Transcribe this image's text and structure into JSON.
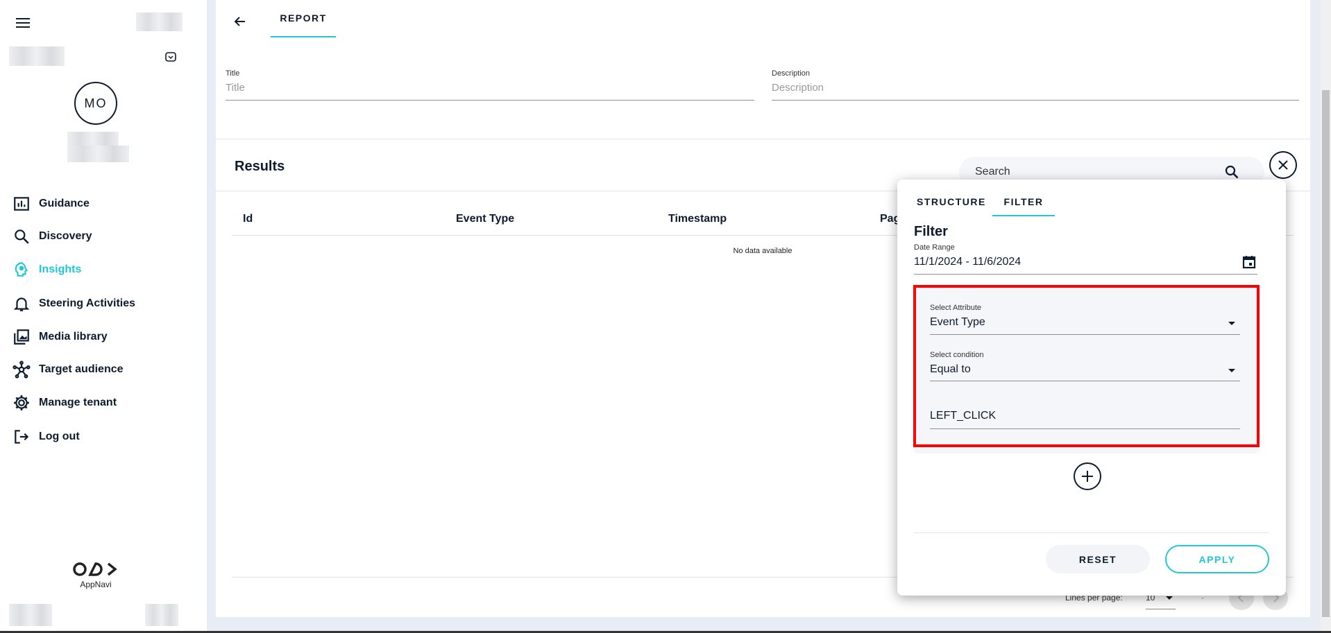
{
  "colors": {
    "accent": "#1ec8d8",
    "text": "#0d1b2e",
    "highlight": "#ff0000"
  },
  "sidebar": {
    "avatar_initials": "MO",
    "items": [
      {
        "label": "Guidance",
        "icon": "bar-chart-icon"
      },
      {
        "label": "Discovery",
        "icon": "search-icon"
      },
      {
        "label": "Insights",
        "icon": "lightbulb-head-icon",
        "active": true
      },
      {
        "label": "Steering Activities",
        "icon": "bell-icon"
      },
      {
        "label": "Media library",
        "icon": "image-library-icon"
      },
      {
        "label": "Target audience",
        "icon": "network-icon"
      },
      {
        "label": "Manage tenant",
        "icon": "gear-icon"
      },
      {
        "label": "Log out",
        "icon": "logout-icon"
      }
    ],
    "logo_text": "AppNavi"
  },
  "header": {
    "tab": "REPORT"
  },
  "form": {
    "title_label": "Title",
    "title_placeholder": "Title",
    "description_label": "Description",
    "description_placeholder": "Description"
  },
  "results": {
    "title": "Results",
    "search_placeholder": "Search",
    "columns": [
      "Id",
      "Event Type",
      "Timestamp",
      "Pag"
    ],
    "empty": "No data available",
    "lines_per_page_label": "Lines per page:",
    "lines_per_page": "10",
    "range": "-"
  },
  "filter_panel": {
    "tabs": [
      "STRUCTURE",
      "FILTER"
    ],
    "active_tab": "FILTER",
    "heading": "Filter",
    "date_range_label": "Date Range",
    "date_range": "11/1/2024 - 11/6/2024",
    "attribute_label": "Select Attribute",
    "attribute": "Event Type",
    "condition_label": "Select condition",
    "condition": "Equal to",
    "value": "LEFT_CLICK",
    "reset": "RESET",
    "apply": "APPLY"
  }
}
